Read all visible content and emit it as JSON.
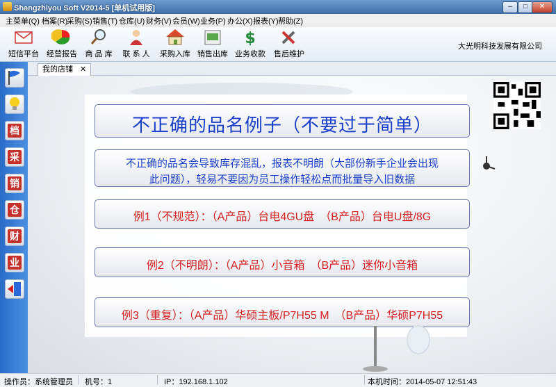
{
  "window": {
    "title": "Shangzhiyou Soft V2014-5 [单机试用版]",
    "buttons": {
      "minimize": "–",
      "maximize": "□",
      "close": "✕"
    }
  },
  "menu": {
    "items": [
      "主菜单(Q)",
      "档案(R)",
      "采购(S)",
      "销售(T)",
      "仓库(U)",
      "财务(V)",
      "会员(W)",
      "业务(P)",
      "办公(X)",
      "报表(Y)",
      "帮助(Z)"
    ]
  },
  "toolbar": {
    "items": [
      {
        "label": "短信平台",
        "icon": "envelope-icon"
      },
      {
        "label": "经营报告",
        "icon": "pie-chart-icon"
      },
      {
        "label": "商 品 库",
        "icon": "magnifier-icon"
      },
      {
        "label": "联 系 人",
        "icon": "person-icon"
      },
      {
        "label": "采购入库",
        "icon": "house-icon"
      },
      {
        "label": "销售出库",
        "icon": "cash-icon"
      },
      {
        "label": "业务收款",
        "icon": "dollar-icon"
      },
      {
        "label": "售后维护",
        "icon": "tools-icon"
      }
    ],
    "company": "大光明科技发展有限公司"
  },
  "sidebar": {
    "items": [
      {
        "icon": "flag-icon",
        "glyph": ""
      },
      {
        "icon": "lightbulb-icon",
        "glyph": ""
      },
      {
        "icon": "archive-seal-icon",
        "glyph": "档"
      },
      {
        "icon": "purchase-seal-icon",
        "glyph": "采"
      },
      {
        "icon": "sales-seal-icon",
        "glyph": "销"
      },
      {
        "icon": "warehouse-seal-icon",
        "glyph": "仓"
      },
      {
        "icon": "finance-seal-icon",
        "glyph": "财"
      },
      {
        "icon": "business-seal-icon",
        "glyph": "业"
      },
      {
        "icon": "exit-door-icon",
        "glyph": ""
      }
    ]
  },
  "tab": {
    "label": "我的店铺",
    "close": "✕"
  },
  "content": {
    "title": "不正确的品名例子（不要过于简单）",
    "note_line1": "不正确的品名会导致库存混乱，报表不明朗（大部份新手企业会出现",
    "note_line2": "此问题），轻易不要因为员工操作轻松点而批量导入旧数据",
    "examples": [
      "例1（不规范）：（A产品）台电4GU盘　（B产品）台电U盘/8G",
      "例2（不明朗）：（A产品）小音箱　（B产品）迷你小音箱",
      "例3（重复）：（A产品）华硕主板/P7H55 M　（B产品）华硕P7H55"
    ],
    "colors": {
      "title": "#1a3fc8",
      "note": "#1a3fc8",
      "example": "#d42020"
    }
  },
  "status": {
    "operator": "操作员：系统管理员",
    "machine": "机号：1",
    "ip": "IP：192.168.1.102",
    "time": "本机时间：2014-05-07 12:51:43"
  }
}
